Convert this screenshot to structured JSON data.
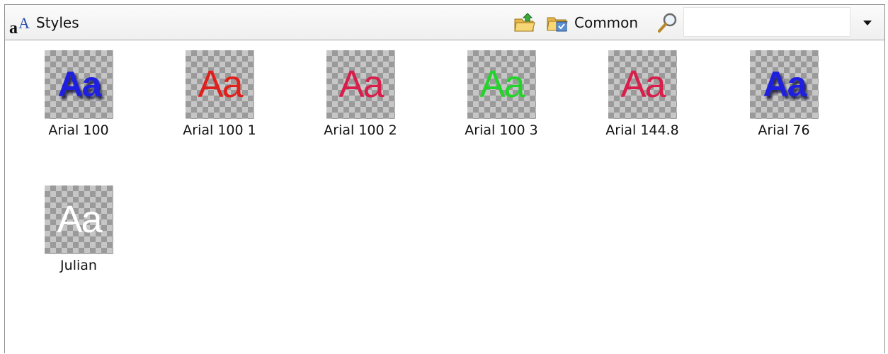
{
  "toolbar": {
    "title": "Styles",
    "title_icon": "font-styles-icon",
    "import_icon": "folder-import-icon",
    "library_icon": "folder-library-icon",
    "library_label": "Common",
    "search_icon": "magnifier-icon",
    "search_value": "",
    "dropdown_icon": "triangle-down-icon"
  },
  "styles": [
    {
      "label": "Arial 100",
      "sample": "Aa",
      "color": "#1f1fe0",
      "bold": true,
      "shadow": true
    },
    {
      "label": "Arial 100 1",
      "sample": "Aa",
      "color": "#e0201c",
      "bold": false,
      "shadow": false
    },
    {
      "label": "Arial 100 2",
      "sample": "Aa",
      "color": "#d81e4a",
      "bold": false,
      "shadow": false
    },
    {
      "label": "Arial 100 3",
      "sample": "Aa",
      "color": "#22d42a",
      "bold": false,
      "shadow": false
    },
    {
      "label": "Arial 144.8",
      "sample": "Aa",
      "color": "#d81e4a",
      "bold": false,
      "shadow": false
    },
    {
      "label": "Arial 76",
      "sample": "Aa",
      "color": "#1f1fe0",
      "bold": true,
      "shadow": true
    },
    {
      "label": "Julian",
      "sample": "Aa",
      "color": "#ffffff",
      "bold": false,
      "shadow": false
    }
  ]
}
